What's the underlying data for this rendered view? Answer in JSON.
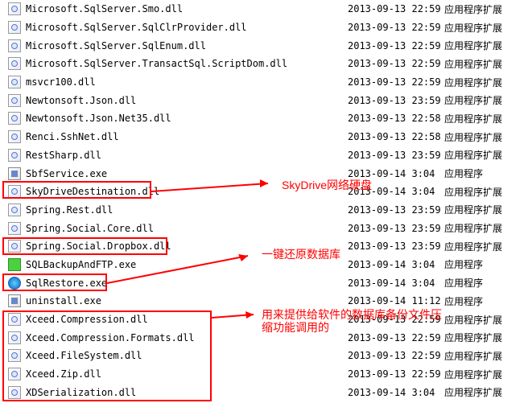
{
  "files": [
    {
      "name": "Microsoft.SqlServer.Smo.dll",
      "date": "2013-09-13 22:59",
      "type": "应用程序扩展",
      "icon": "dll"
    },
    {
      "name": "Microsoft.SqlServer.SqlClrProvider.dll",
      "date": "2013-09-13 22:59",
      "type": "应用程序扩展",
      "icon": "dll"
    },
    {
      "name": "Microsoft.SqlServer.SqlEnum.dll",
      "date": "2013-09-13 22:59",
      "type": "应用程序扩展",
      "icon": "dll"
    },
    {
      "name": "Microsoft.SqlServer.TransactSql.ScriptDom.dll",
      "date": "2013-09-13 22:59",
      "type": "应用程序扩展",
      "icon": "dll"
    },
    {
      "name": "msvcr100.dll",
      "date": "2013-09-13 22:59",
      "type": "应用程序扩展",
      "icon": "dll"
    },
    {
      "name": "Newtonsoft.Json.dll",
      "date": "2013-09-13 23:59",
      "type": "应用程序扩展",
      "icon": "dll"
    },
    {
      "name": "Newtonsoft.Json.Net35.dll",
      "date": "2013-09-13 22:58",
      "type": "应用程序扩展",
      "icon": "dll"
    },
    {
      "name": "Renci.SshNet.dll",
      "date": "2013-09-13 22:58",
      "type": "应用程序扩展",
      "icon": "dll"
    },
    {
      "name": "RestSharp.dll",
      "date": "2013-09-13 23:59",
      "type": "应用程序扩展",
      "icon": "dll"
    },
    {
      "name": "SbfService.exe",
      "date": "2013-09-14 3:04",
      "type": "应用程序",
      "icon": "exe"
    },
    {
      "name": "SkyDriveDestination.dll",
      "date": "2013-09-14 3:04",
      "type": "应用程序扩展",
      "icon": "dll"
    },
    {
      "name": "Spring.Rest.dll",
      "date": "2013-09-13 23:59",
      "type": "应用程序扩展",
      "icon": "dll"
    },
    {
      "name": "Spring.Social.Core.dll",
      "date": "2013-09-13 23:59",
      "type": "应用程序扩展",
      "icon": "dll"
    },
    {
      "name": "Spring.Social.Dropbox.dll",
      "date": "2013-09-13 23:59",
      "type": "应用程序扩展",
      "icon": "dll"
    },
    {
      "name": "SQLBackupAndFTP.exe",
      "date": "2013-09-14 3:04",
      "type": "应用程序",
      "icon": "exe-green"
    },
    {
      "name": "SqlRestore.exe",
      "date": "2013-09-14 3:04",
      "type": "应用程序",
      "icon": "exe-blue"
    },
    {
      "name": "uninstall.exe",
      "date": "2013-09-14 11:12",
      "type": "应用程序",
      "icon": "exe"
    },
    {
      "name": "Xceed.Compression.dll",
      "date": "2013-09-13 22:59",
      "type": "应用程序扩展",
      "icon": "dll"
    },
    {
      "name": "Xceed.Compression.Formats.dll",
      "date": "2013-09-13 22:59",
      "type": "应用程序扩展",
      "icon": "dll"
    },
    {
      "name": "Xceed.FileSystem.dll",
      "date": "2013-09-13 22:59",
      "type": "应用程序扩展",
      "icon": "dll"
    },
    {
      "name": "Xceed.Zip.dll",
      "date": "2013-09-13 22:59",
      "type": "应用程序扩展",
      "icon": "dll"
    },
    {
      "name": "XDSerialization.dll",
      "date": "2013-09-14 3:04",
      "type": "应用程序扩展",
      "icon": "dll"
    }
  ],
  "annotations": {
    "skydrive": "SkyDrive网络硬盘",
    "restore": "一键还原数据库",
    "xceed_line1": "用来提供给软件的数据库备份文件压",
    "xceed_line2": "缩功能调用的"
  }
}
